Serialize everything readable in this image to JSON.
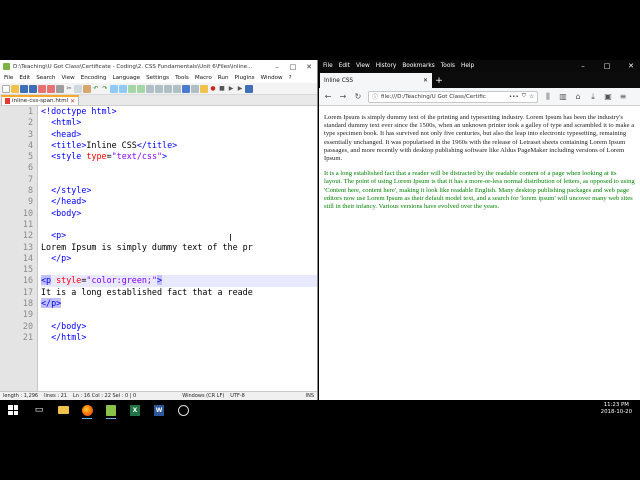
{
  "npp": {
    "title": "D:\\Teaching\\U Got Class\\Certificate - Coding\\2. CSS Fundamentals\\Unit 6\\Files\\inline...",
    "menu": [
      "File",
      "Edit",
      "Search",
      "View",
      "Encoding",
      "Language",
      "Settings",
      "Tools",
      "Macro",
      "Run",
      "Plugins",
      "Window",
      "?"
    ],
    "tab_label": "inline-css-span.html",
    "line_numbers": [
      "1",
      "2",
      "3",
      "4",
      "5",
      "6",
      "7",
      "8",
      "9",
      "10",
      "11",
      "12",
      "13",
      "14",
      "15",
      "16",
      "17",
      "18",
      "19",
      "20",
      "21"
    ],
    "code": {
      "l1_a": "<!",
      "l1_b": "doctype html",
      "l1_c": ">",
      "l2": "<html>",
      "l3": "<head>",
      "l4_a": "<title>",
      "l4_b": "Inline CSS",
      "l4_c": "</title>",
      "l5_a": "<style ",
      "l5_b": "type",
      "l5_c": "=",
      "l5_d": "\"text/css\"",
      "l5_e": ">",
      "l8": "</style>",
      "l9": "</head>",
      "l10": "<body>",
      "l12": "<p>",
      "l13": "Lorem Ipsum is simply dummy text of the pr",
      "l14": "</p>",
      "l16_a": "<p",
      "l16_b": " style",
      "l16_c": "=",
      "l16_d": "\"color:green;\"",
      "l16_e": ">",
      "l17": "It is a long established fact that a reade",
      "l18": "</p>",
      "l20": "</body>",
      "l21": "</html>"
    },
    "status": {
      "length": "length : 1,296",
      "lines": "lines : 21",
      "position": "Ln : 16    Col : 22    Sel : 0 | 0",
      "eol": "Windows (CR LF)",
      "encoding": "UTF-8",
      "mode": "INS"
    }
  },
  "firefox": {
    "menu": [
      "File",
      "Edit",
      "View",
      "History",
      "Bookmarks",
      "Tools",
      "Help"
    ],
    "tab_title": "Inline CSS",
    "url": "file:///D:/Teaching/U Got Class/Certific",
    "paragraph1": "Lorem Ipsum is simply dummy text of the printing and typesetting industry. Lorem Ipsum has been the industry's standard dummy text ever since the 1500s, when an unknown printer took a galley of type and scrambled it to make a type specimen book. It has survived not only five centuries, but also the leap into electronic typesetting, remaining essentially unchanged. It was popularised in the 1960s with the release of Letraset sheets containing Lorem Ipsum passages, and more recently with desktop publishing software like Aldus PageMaker including versions of Lorem Ipsum.",
    "paragraph2": "It is a long established fact that a reader will be distracted by the readable content of a page when looking at its layout. The point of using Lorem Ipsum is that it has a more-or-less normal distribution of letters, as opposed to using 'Content here, content here', making it look like readable English. Many desktop publishing packages and web page editors now use Lorem Ipsum as their default model text, and a search for 'lorem ipsum' will uncover many web sites still in their infancy. Various versions have evolved over the years.",
    "paragraph2_color": "#008000"
  },
  "taskbar": {
    "time": "11:23 PM",
    "date": "2018-10-20"
  }
}
